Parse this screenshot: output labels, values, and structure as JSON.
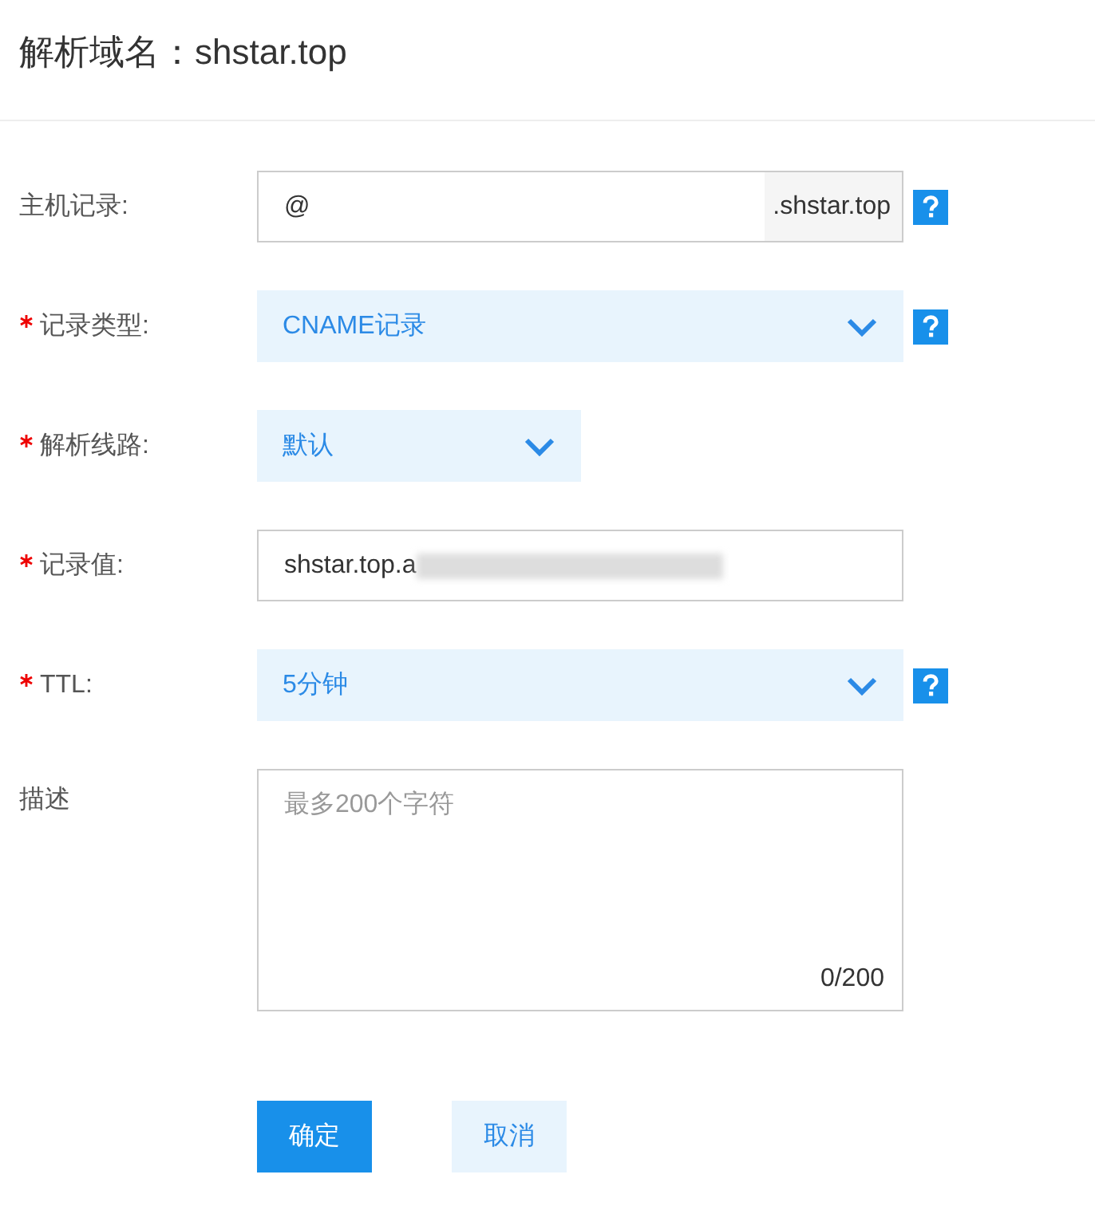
{
  "title": "解析域名：shstar.top",
  "fields": [
    {
      "kind": "text",
      "label": "主机记录:",
      "required": false,
      "value": "@",
      "suffix": ".shstar.top",
      "help": true
    },
    {
      "kind": "select",
      "label": "记录类型:",
      "required": true,
      "value": "CNAME记录",
      "help": true
    },
    {
      "kind": "short-select",
      "label": "解析线路:",
      "required": true,
      "value": "默认",
      "help": false
    },
    {
      "kind": "text",
      "label": "记录值:",
      "required": true,
      "value": "shstar.top.a",
      "redacted": true,
      "help": false
    },
    {
      "kind": "select",
      "label": "TTL:",
      "required": true,
      "value": "5分钟",
      "help": true
    },
    {
      "kind": "textarea",
      "label": "描述",
      "required": false,
      "placeholder": "最多200个字符",
      "counter": "0/200",
      "help": false
    }
  ],
  "buttons": [
    {
      "kind": "primary",
      "label": "确定"
    },
    {
      "kind": "secondary",
      "label": "取消"
    }
  ]
}
